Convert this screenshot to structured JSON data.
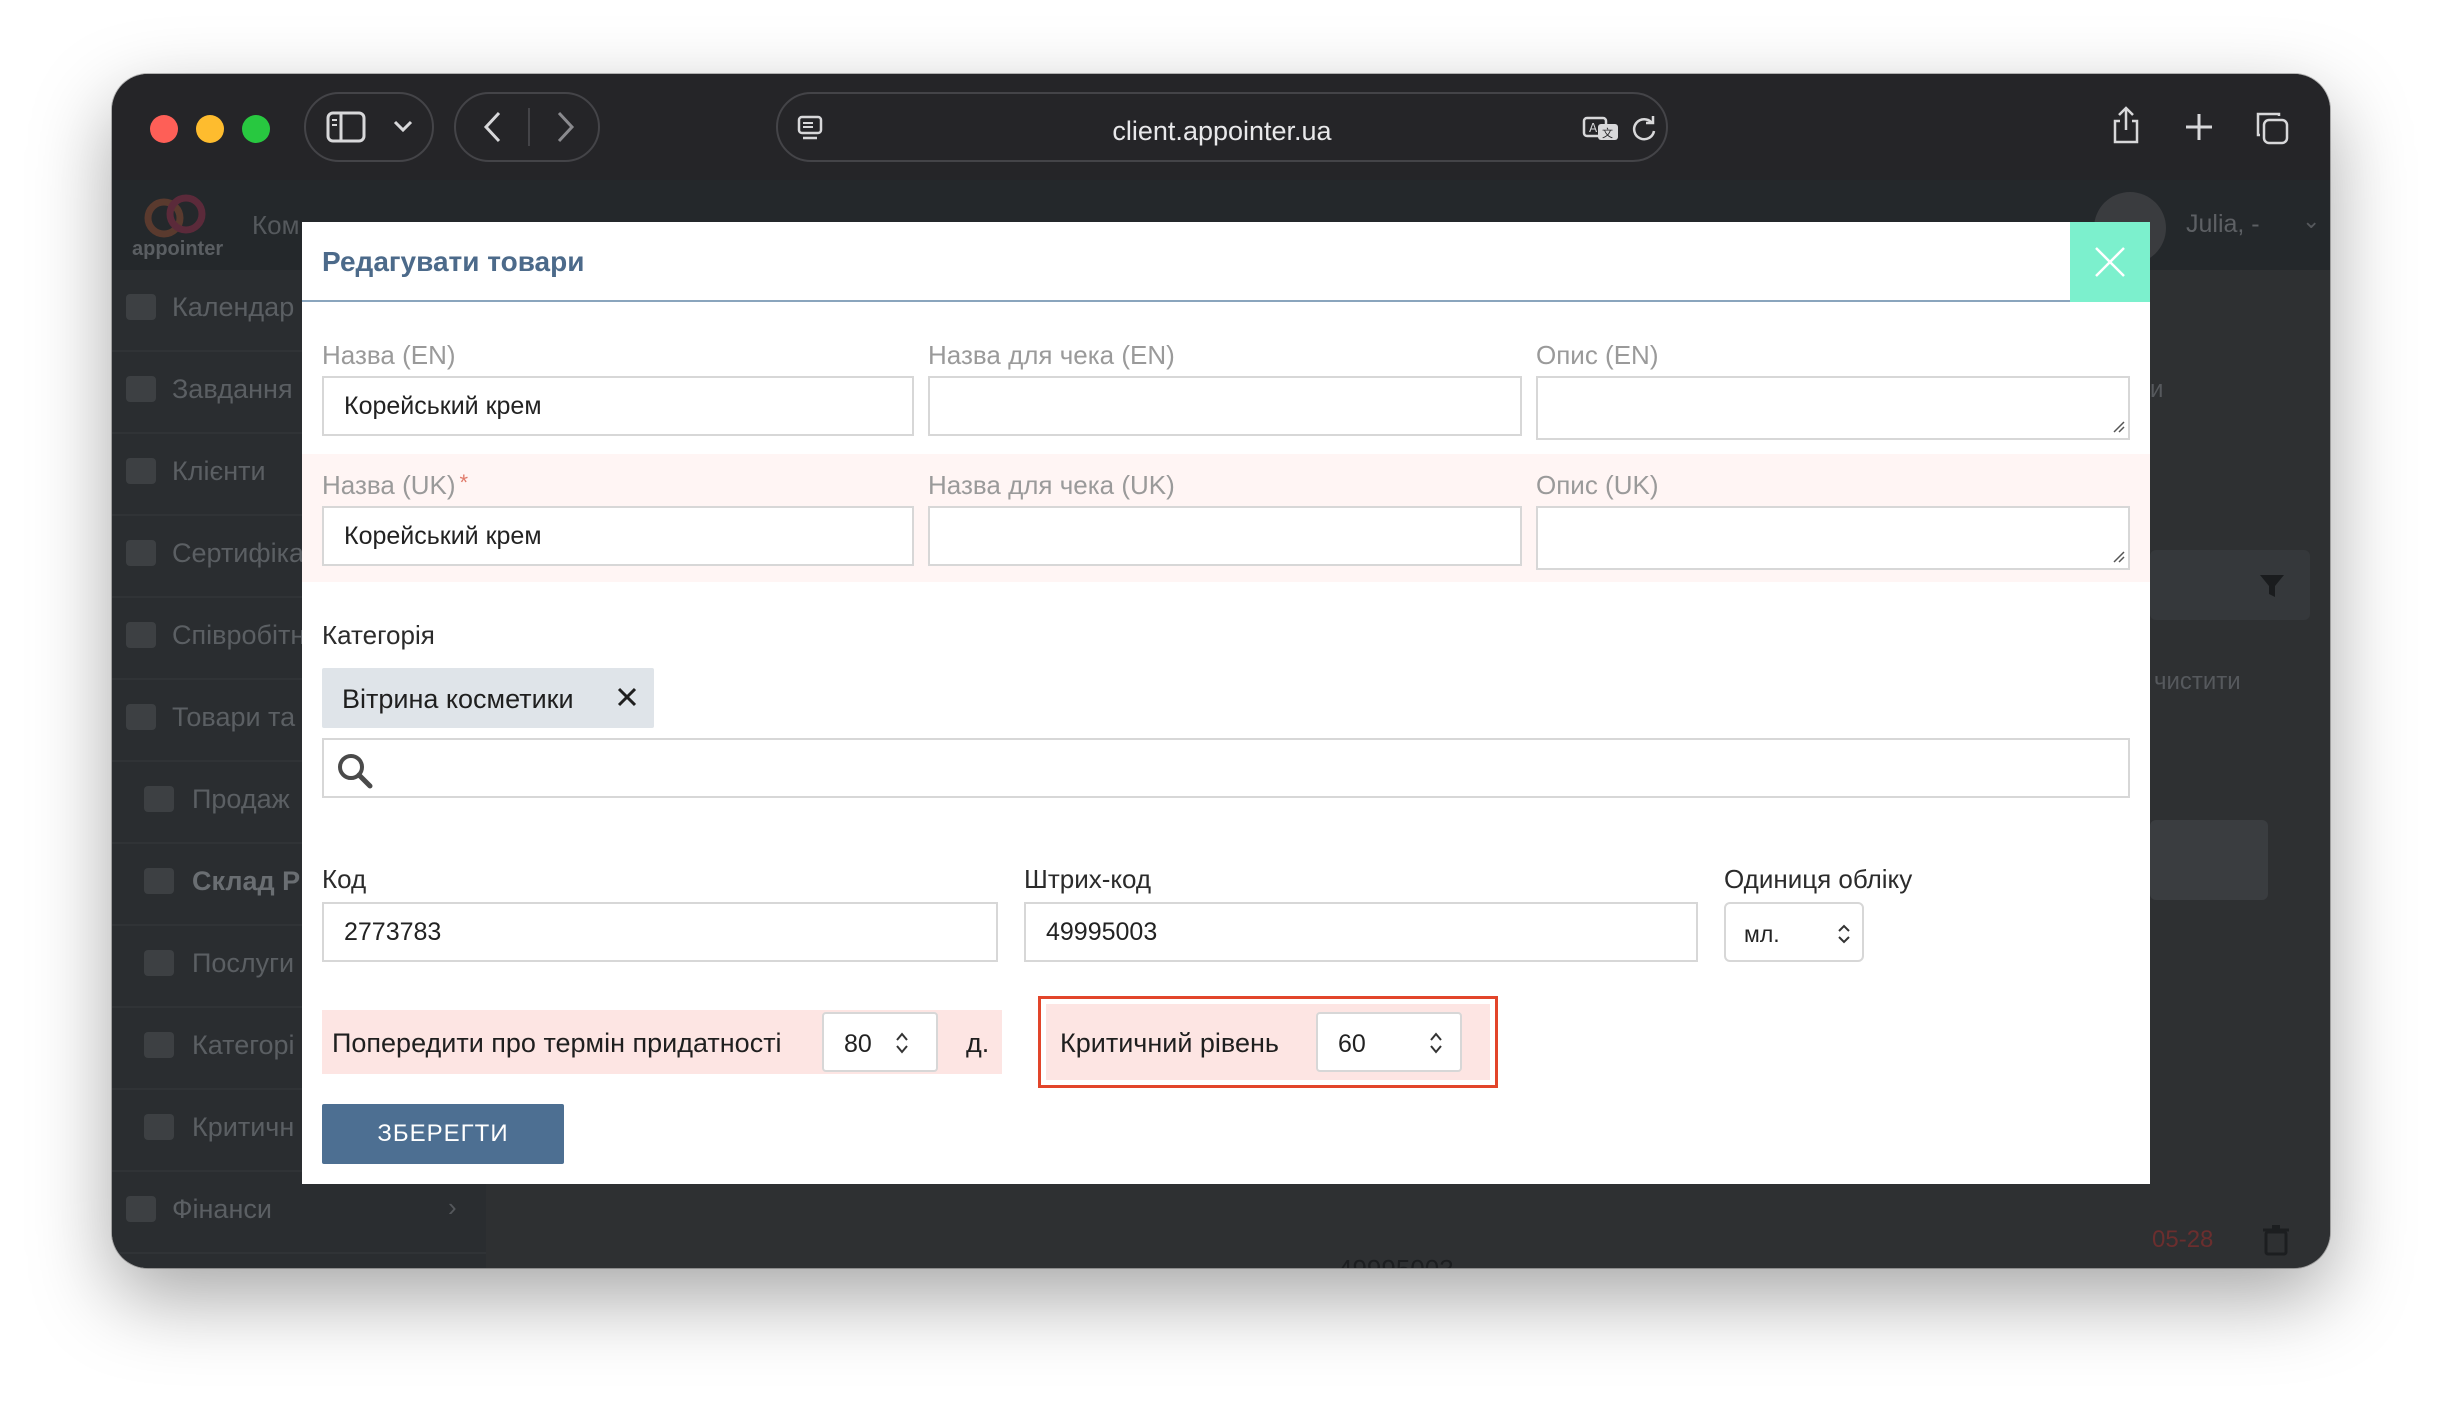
{
  "browser": {
    "url": "client.appointer.ua"
  },
  "background_page": {
    "logo_text": "appointer",
    "header_fragment": "Ком",
    "user_name": "Julia, -",
    "sidebar": [
      {
        "label": "Календар"
      },
      {
        "label": "Завдання"
      },
      {
        "label": "Клієнти"
      },
      {
        "label": "Сертифіка"
      },
      {
        "label": "Співробітн"
      },
      {
        "label": "Товари та"
      },
      {
        "label": "Продаж"
      },
      {
        "label": "Склад Р"
      },
      {
        "label": "Послуги"
      },
      {
        "label": "Категорі"
      },
      {
        "label": "Критичн"
      },
      {
        "label": "Фінанси"
      }
    ],
    "fragment_clear": "чистити",
    "fragment_date": "05-28",
    "fragment_barcode": "49995003",
    "fragment_right_top": "и"
  },
  "modal": {
    "title": "Редагувати товари",
    "name_en_label": "Назва (EN)",
    "name_en_value": "Корейський крем",
    "receipt_name_en_label": "Назва для чека (EN)",
    "receipt_name_en_value": "",
    "desc_en_label": "Опис (EN)",
    "name_uk_label": "Назва (UK)",
    "name_uk_required": "*",
    "name_uk_value": "Корейський крем",
    "receipt_name_uk_label": "Назва для чека (UK)",
    "receipt_name_uk_value": "",
    "desc_uk_label": "Опис (UK)",
    "category_label": "Категорія",
    "category_tag": "Вітрина косметики",
    "code_label": "Код",
    "code_value": "2773783",
    "barcode_label": "Штрих-код",
    "barcode_value": "49995003",
    "unit_label": "Одиниця обліку",
    "unit_value": "мл.",
    "expiry_warn_label": "Попередити про термін придатності",
    "expiry_warn_value": "80",
    "expiry_warn_unit": "д.",
    "critical_level_label": "Критичний рівень",
    "critical_level_value": "60",
    "save_label": "ЗБЕРЕГТИ"
  },
  "colors": {
    "modal_title": "#4c6a8a",
    "close_button": "#7cf0cd",
    "save_button": "#4d6f92",
    "highlight_border": "#e2452a",
    "row_tint": "#fde5e3"
  }
}
